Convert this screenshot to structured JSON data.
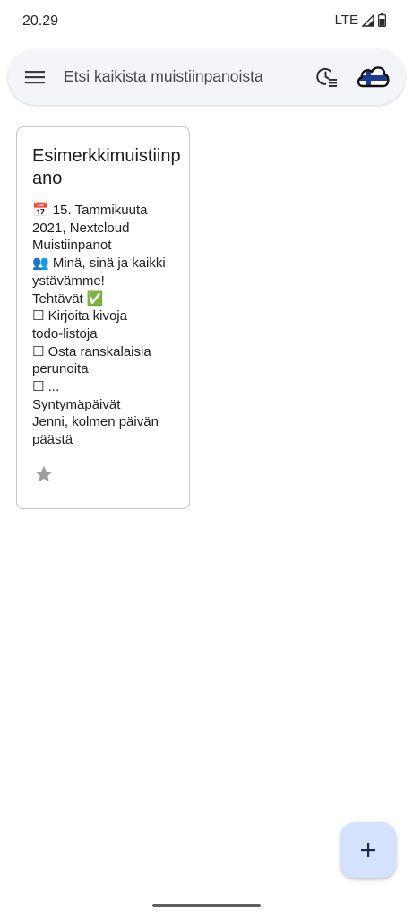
{
  "status_bar": {
    "time": "20.29",
    "network": "LTE"
  },
  "search": {
    "placeholder": "Etsi kaikista muistiinpanoista"
  },
  "icons": {
    "menu": "menu-icon",
    "filter": "time-sort-icon",
    "account": "nextcloud-account-avatar",
    "favorite": "star-icon",
    "fab": "plus-icon"
  },
  "colors": {
    "search_bg": "#f4f5f9",
    "fab_bg": "#d3e3fd",
    "star": "#9e9e9e",
    "card_border": "#c8c8c8"
  },
  "notes": [
    {
      "title": "Esimerkkimuistiinpano",
      "excerpt_lines": [
        "📅 15. Tammikuuta",
        "2021, Nextcloud",
        "Muistiinpanot",
        "👥 Minä, sinä ja kaikki",
        "ystävämme!",
        "Tehtävät ✅",
        "☐ Kirjoita kivoja",
        "todo-listoja",
        "☐ Osta ranskalaisia",
        "perunoita",
        "☐ ...",
        "Syntymäpäivät",
        "Jenni, kolmen päivän",
        "päästä"
      ],
      "favorite": false
    }
  ]
}
